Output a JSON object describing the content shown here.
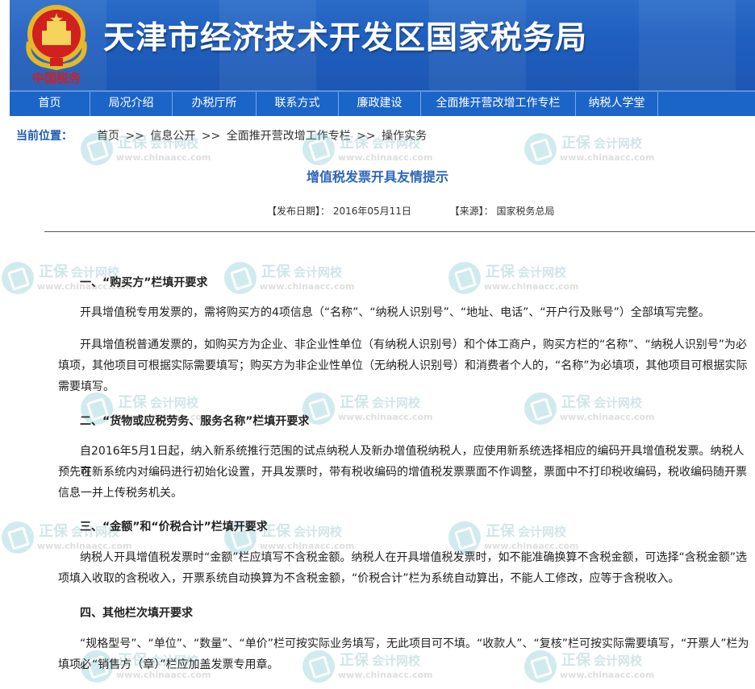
{
  "header": {
    "title": "天津市经济技术开发区国家税务局",
    "emblem_text": "中国税务"
  },
  "nav": {
    "items": [
      "首页",
      "局况介绍",
      "办税厅所",
      "联系方式",
      "廉政建设",
      "全面推开营改增工作专栏",
      "纳税人学堂"
    ]
  },
  "breadcrumb": {
    "label": "当前位置：",
    "items": [
      "首页",
      "信息公开",
      "全面推开营改增工作专栏",
      "操作实务"
    ],
    "separator": ">>"
  },
  "article": {
    "title": "增值税发票开具友情提示",
    "date_label": "【发布日期】：",
    "date": "2016年05月11日",
    "source_label": "【来源】：",
    "source": "国家税务总局",
    "h1": "一、“购买方”栏填开要求",
    "p1": "开具增值税专用发票的，需将购买方的4项信息（“名称”、“纳税人识别号”、“地址、电话”、“开户行及账号”）全部填写完整。",
    "p2a": "开具增值税普通发票的，如购买方为企业、非企业性单位（有纳税人识别号）和个体工商户，购买方栏的“名称”、“纳税人识别号”为必",
    "p2b": "填项，其他项目可根据实际需要填写；购买方为非企业性单位（无纳税人识别号）和消费者个人的，“名称”为必填项，其他项目可根据实际",
    "p2c": "需要填写。",
    "h2": "二、“货物或应税劳务、服务名称”栏填开要求",
    "p3a": "自2016年5月1日起，纳入新系统推行范围的试点纳税人及新办增值税纳税人，应使用新系统选择相应的编码开具增值税发票。纳税人可",
    "p3b": "预先在新系统内对编码进行初始化设置，开具发票时，带有税收编码的增值税发票票面不作调整，票面中不打印税收编码，税收编码随开票",
    "p3c": "信息一并上传税务机关。",
    "h3": "三、“金额”和“价税合计”栏填开要求",
    "p4a": "纳税人开具增值税发票时“金额”栏应填写不含税金额。纳税人在开具增值税发票时，如不能准确换算不含税金额，可选择“含税金额”选",
    "p4b": "项填入收取的含税收入，开票系统自动换算为不含税金额，“价税合计”栏为系统自动算出，不能人工修改，应等于含税收入。",
    "h4": "四、其他栏次填开要求",
    "p5a": "“规格型号”、“单位”、“数量”、“单价”栏可按实际业务填写，无此项目可不填。“收款人”、“复核”栏可按实际需要填写，“开票人”栏为必",
    "p5b": "填项，“销售方（章）”栏应加盖发票专用章。"
  },
  "watermark": {
    "brand": "正保",
    "sub": "会计网校",
    "url": "www.chinaacc.com"
  },
  "colors": {
    "header_blue": "#1f5fbf",
    "nav_blue": "#1b64c8",
    "title_blue": "#2d66b8",
    "emblem_red": "#d21f1f",
    "emblem_gold": "#e5b829"
  }
}
